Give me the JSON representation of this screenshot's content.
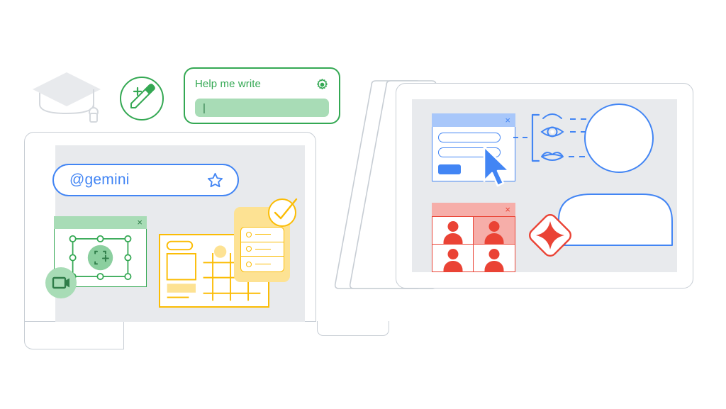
{
  "illustration": {
    "title": "Google Workspace AI collaboration illustration",
    "palette": {
      "blue": "#4285f4",
      "blue_light": "#a8c7fa",
      "green": "#34a853",
      "green_light": "#a8dcb6",
      "yellow": "#fbbc04",
      "yellow_light": "#fde293",
      "red": "#ea4335",
      "red_light": "#f6aea9",
      "gray_screen": "#e8eaed",
      "gray_outline": "#c7cdd4",
      "white": "#ffffff"
    }
  },
  "grad_cap": {
    "icon": "graduation-cap-icon",
    "label": "Graduation cap"
  },
  "pencil_badge": {
    "icon": "pencil-plus-icon",
    "label": "Create new"
  },
  "help_card": {
    "title": "Help me write",
    "gear_icon": "gear-icon",
    "input_value": "",
    "input_placeholder": "",
    "caret": "|"
  },
  "laptop": {
    "label": "Laptop",
    "trackpad_label": "Trackpad"
  },
  "gemini_bar": {
    "query": "@gemini",
    "placeholder": "@gemini",
    "star_icon": "star-icon"
  },
  "green_window": {
    "close_label": "×",
    "title": "",
    "crop_icon": "crop-add-icon",
    "video_icon": "video-camera-icon"
  },
  "yellow_doc": {
    "title": "",
    "card": {
      "items": [
        {
          "radio": "radio-icon",
          "line": ""
        },
        {
          "radio": "radio-icon",
          "line": ""
        },
        {
          "radio": "radio-icon",
          "line": ""
        }
      ]
    },
    "check_icon": "check-circle-icon"
  },
  "tablet": {
    "label": "Tablet",
    "stack_layers": 2
  },
  "blue_window": {
    "close_label": "×",
    "field_1": "",
    "field_2": "",
    "button_label": "",
    "cursor_icon": "mouse-cursor-icon"
  },
  "face_diagram": {
    "bracket_icon": "bracket-icon",
    "eyebrow_icon": "eyebrow-icon",
    "eye_icon": "eye-icon",
    "mouth_icon": "mouth-icon",
    "head_icon": "head-circle-icon",
    "body_icon": "body-shape-icon"
  },
  "red_window": {
    "close_label": "×",
    "tiles": [
      {
        "name": "participant-1",
        "highlighted": false
      },
      {
        "name": "participant-2",
        "highlighted": true
      },
      {
        "name": "participant-3",
        "highlighted": false
      },
      {
        "name": "participant-4",
        "highlighted": false
      }
    ],
    "spark_icon": "sparkle-diamond-icon"
  }
}
